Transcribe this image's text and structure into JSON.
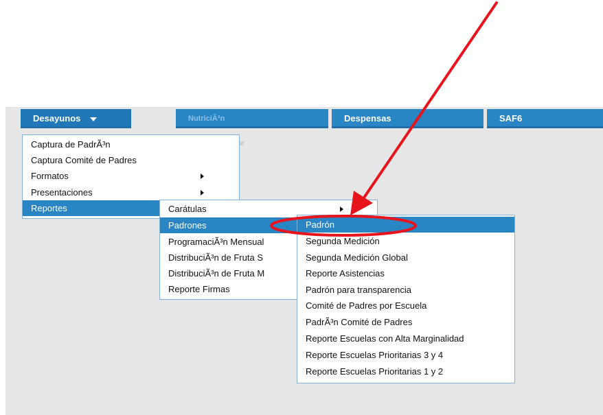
{
  "nav": {
    "tabs": [
      {
        "label": "Desayunos"
      },
      {
        "label": "NutriciÃ³n"
      },
      {
        "label": "Despensas"
      },
      {
        "label": "SAF6"
      }
    ]
  },
  "ghost_text": "ar",
  "menu1": {
    "items": [
      {
        "label": "Captura de PadrÃ³n"
      },
      {
        "label": "Captura Comité de Padres"
      },
      {
        "label": "Formatos"
      },
      {
        "label": "Presentaciones"
      },
      {
        "label": "Reportes"
      }
    ]
  },
  "menu2": {
    "items": [
      {
        "label": "Carátulas"
      },
      {
        "label": "Padrones"
      },
      {
        "label": "ProgramaciÃ³n Mensual"
      },
      {
        "label": "DistribuciÃ³n de Fruta S"
      },
      {
        "label": "DistribuciÃ³n de Fruta M"
      },
      {
        "label": "Reporte Firmas"
      }
    ]
  },
  "menu3": {
    "items": [
      {
        "label": "Padrón"
      },
      {
        "label": "Segunda Medición"
      },
      {
        "label": "Segunda Medición Global"
      },
      {
        "label": "Reporte Asistencias"
      },
      {
        "label": "Padrón para transparencia"
      },
      {
        "label": "Comité de Padres por Escuela"
      },
      {
        "label": "PadrÃ³n Comité de Padres"
      },
      {
        "label": "Reporte Escuelas con Alta Marginalidad"
      },
      {
        "label": "Reporte Escuelas Prioritarias 3 y 4"
      },
      {
        "label": "Reporte Escuelas Prioritarias 1 y 2"
      }
    ]
  },
  "colors": {
    "accent": "#2a85c4",
    "annotation": "#e8141c"
  }
}
